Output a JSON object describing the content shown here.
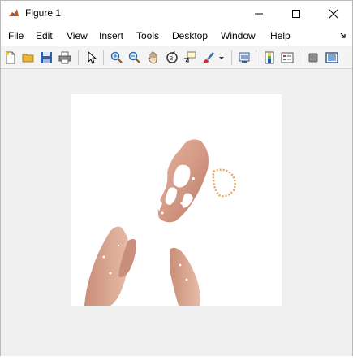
{
  "window": {
    "title": "Figure 1",
    "icons": [
      "matlab-icon",
      "minimize-icon",
      "maximize-icon",
      "close-icon"
    ]
  },
  "menu": {
    "items": [
      "File",
      "Edit",
      "View",
      "Insert",
      "Tools",
      "Desktop",
      "Window",
      "Help"
    ]
  },
  "toolbar": {
    "icons": [
      "new-figure-icon",
      "open-file-icon",
      "save-icon",
      "print-icon",
      "pointer-icon",
      "zoom-in-icon",
      "zoom-out-icon",
      "pan-icon",
      "rotate-3d-icon",
      "data-cursor-icon",
      "brush-icon",
      "brush-dropdown-icon",
      "link-plot-icon",
      "insert-colorbar-icon",
      "insert-legend-icon",
      "hide-plot-tools-icon",
      "show-plot-tools-icon"
    ]
  },
  "figure": {
    "content": "3d-surface-plot",
    "surface_color": "#d9a08a"
  }
}
